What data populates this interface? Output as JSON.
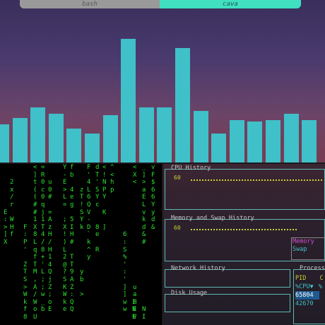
{
  "tabs": [
    {
      "label": "bash"
    },
    {
      "label": "cava"
    }
  ],
  "visualizer": {
    "levels": [
      0.25,
      0.29,
      0.36,
      0.32,
      0.22,
      0.19,
      0.31,
      0.81,
      0.36,
      0.36,
      0.75,
      0.34,
      0.19,
      0.28,
      0.27,
      0.28,
      0.32,
      0.28
    ],
    "bar_color": "#40c0c8"
  },
  "matrix": {
    "columns": [
      " \n \n \n \n \n \nE\n:\n>\n]\nX",
      " \n \n2\nx\n/\nr\n \nW\nH\nf",
      " \n \n \n \n \n \n \n \n \n \n \n \n \n \n \n \n \n \n \n ",
      " \n \n \n \n \n \n \n \nF\n:\nP\n'\n \nZ\nT\nS\n>\nW\nk\nf\n8",
      "<\n]\nt\n(\n(\n#\n#\n1\nX\n8\nL\nq\nf\nT\nM\n,\nA\n/\nW\no\nU",
      "=\nR\n0\nc\n0\nq\nj\n1\nT\n4\n/\n8\n+\n'\nL\n;\n;\nw\n_\nb",
      " \n \nu\n0\n#\n \n=\nA\nz\nH\n/\nH\n1\n4\nQ\nj\nZ\n;\no\nE",
      "Y\n-\nE\n>\nL\n=\n \n;\nX\n!\n)\nL\n2\n@\n?\nS\nK\nW\nk\ne",
      "f\nb\n \n4\ne\ng\n \n5\nI\nH\n#\n \nT\nT\n9\nA\nZ\n:\nQ\nQ",
      " \n \n \nz\nT\n!\nS\nY\nk\n \n \n \n \n \ny\nb\n \n>\n \n ",
      "F\n'\n4\nL\n6\nQ\nV\n-\nD\n`\nk\n^\ny\n \n \n \n \n \n \n ",
      "d\nT\n'\nS\nY\nc\n \n \n8\ne\n \nR\n \n \n \n \n \n \n \n ",
      "<\n!\nN\nP\nY\n \nK\n \n]\n \n \n \n \n \n \n \n \n \n \n ",
      "^\n<\nh\np\n \n \n \n \n \n \n \n \n \n \n \n \n \n \n \n ",
      " \n \n \n \n \n \n \n \n \n6\n:\nS\n%\n'\n:\n'\n]\n]\nw\nw",
      " \n \n \n \n \n \n \n \n \n \n \n \n \n \n \n \n \n \nI\nN\nE",
      "<\nX\n<\n \n \n \n \n \n \n \n \n \n \n \n \n \nu\na\nH\nE\nV",
      "_\n]\n>\na\nE\nL\nv\nk\nd\n&\n#\n \n \n \n \n \n \n \n \nN\nI",
      "v\nF\n$\n6\n6\nY\ny\nd\n&\n \n \n \n \n \n \n \n \n \n \n \n "
    ]
  },
  "panels": {
    "cpu": {
      "title": "CPU History",
      "value": "60"
    },
    "memory": {
      "title": "Memory and Swap History",
      "value": "60",
      "legend": [
        {
          "label": "Memory",
          "color": "#d050d0"
        },
        {
          "label": "Swap",
          "color": "#40c0c8"
        }
      ]
    },
    "network": {
      "title": "Network History"
    },
    "disk": {
      "title": "Disk Usage"
    },
    "processes": {
      "title": "Processes",
      "headers": [
        "PID",
        "C"
      ],
      "subheaders": [
        "%CPU▼",
        "%"
      ],
      "rows": [
        [
          "65804",
          ""
        ],
        [
          "42670",
          ""
        ]
      ]
    }
  },
  "colors": {
    "accent": "#40e0c0",
    "panel_border": "#5fb8b0",
    "graph": "#c8d030",
    "matrix": "#2fe02f"
  }
}
